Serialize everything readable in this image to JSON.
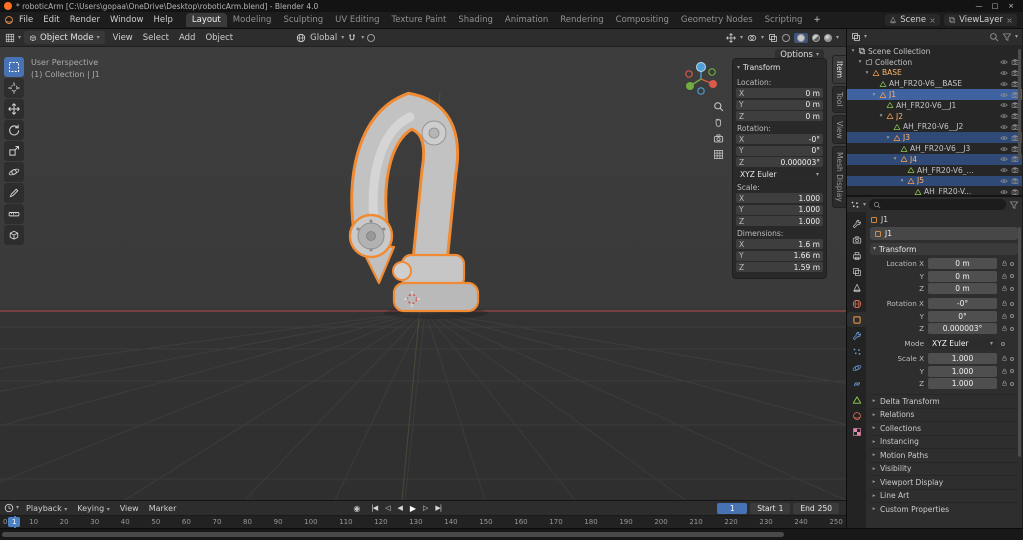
{
  "titlebar": {
    "title": "* roboticArm [C:\\Users\\gopaa\\OneDrive\\Desktop\\roboticArm.blend] - Blender 4.0",
    "controls": {
      "minimize": "—",
      "maximize": "□",
      "close": "×"
    }
  },
  "topbar": {
    "menus": [
      "File",
      "Edit",
      "Render",
      "Window",
      "Help"
    ],
    "workspaces": [
      "Layout",
      "Modeling",
      "Sculpting",
      "UV Editing",
      "Texture Paint",
      "Shading",
      "Animation",
      "Rendering",
      "Compositing",
      "Geometry Nodes",
      "Scripting"
    ],
    "active_workspace": "Layout",
    "add_workspace": "+",
    "scene": "Scene",
    "view_layer": "ViewLayer"
  },
  "viewport_header": {
    "mode": "Object Mode",
    "menus": [
      "View",
      "Select",
      "Add",
      "Object"
    ],
    "orientation": "Global",
    "options": "Options"
  },
  "toolbar": {
    "active": "select-box",
    "tools": [
      {
        "name": "select-box",
        "icon": "select"
      },
      {
        "name": "cursor",
        "icon": "cursor3d"
      },
      {
        "name": "move",
        "icon": "move"
      },
      {
        "name": "rotate",
        "icon": "rotate"
      },
      {
        "name": "scale",
        "icon": "scale"
      },
      {
        "name": "transform",
        "icon": "orbit"
      },
      {
        "name": "annotate",
        "icon": "annotate"
      },
      {
        "name": "measure",
        "icon": "measure"
      },
      {
        "name": "add-cube",
        "icon": "addcube"
      }
    ]
  },
  "viewport": {
    "overlay_line1": "User Perspective",
    "overlay_line2": "(1) Collection | J1"
  },
  "npanel": {
    "title": "Transform",
    "tabs": [
      {
        "label": "Item",
        "active": true
      },
      {
        "label": "Tool"
      },
      {
        "label": "View"
      },
      {
        "label": "Mesh Display"
      }
    ],
    "groups": [
      {
        "label": "Location:",
        "rows": [
          {
            "axis": "X",
            "value": "0 m"
          },
          {
            "axis": "Y",
            "value": "0 m"
          },
          {
            "axis": "Z",
            "value": "0 m"
          }
        ]
      },
      {
        "label": "Rotation:",
        "rows": [
          {
            "axis": "X",
            "value": "-0°"
          },
          {
            "axis": "Y",
            "value": "0°"
          },
          {
            "axis": "Z",
            "value": "0.000003°"
          }
        ],
        "dropdown": "XYZ Euler"
      },
      {
        "label": "Scale:",
        "rows": [
          {
            "axis": "X",
            "value": "1.000"
          },
          {
            "axis": "Y",
            "value": "1.000"
          },
          {
            "axis": "Z",
            "value": "1.000"
          }
        ]
      },
      {
        "label": "Dimensions:",
        "rows": [
          {
            "axis": "X",
            "value": "1.6 m"
          },
          {
            "axis": "Y",
            "value": "1.66 m"
          },
          {
            "axis": "Z",
            "value": "1.59 m"
          }
        ]
      }
    ]
  },
  "outliner": {
    "rows": [
      {
        "label": "Scene Collection",
        "icon": "scenecoll",
        "depth": 0,
        "expand": true,
        "tools": false
      },
      {
        "label": "Collection",
        "icon": "collection",
        "depth": 1,
        "expand": true
      },
      {
        "label": "BASE",
        "icon": "object",
        "depth": 2,
        "expand": true,
        "orange": true
      },
      {
        "label": "AH_FR20-V6__BASE",
        "icon": "mesh",
        "depth": 3
      },
      {
        "label": "J1",
        "icon": "object",
        "depth": 3,
        "expand": true,
        "orange": true,
        "state": "active"
      },
      {
        "label": "AH_FR20-V6__J1",
        "icon": "mesh",
        "depth": 4
      },
      {
        "label": "J2",
        "icon": "object",
        "depth": 4,
        "expand": true,
        "orange": true
      },
      {
        "label": "AH_FR20-V6__J2",
        "icon": "mesh",
        "depth": 5
      },
      {
        "label": "J3",
        "icon": "object",
        "depth": 5,
        "expand": true,
        "orange": true,
        "state": "selected"
      },
      {
        "label": "AH_FR20-V6__J3",
        "icon": "mesh",
        "depth": 6
      },
      {
        "label": "J4",
        "icon": "object",
        "depth": 6,
        "expand": true,
        "orange": true,
        "state": "selected"
      },
      {
        "label": "AH_FR20-V6_...",
        "icon": "mesh",
        "depth": 7
      },
      {
        "label": "J5",
        "icon": "object",
        "depth": 7,
        "expand": true,
        "orange": true,
        "state": "selected"
      },
      {
        "label": "AH_FR20-V...",
        "icon": "mesh",
        "depth": 8
      }
    ]
  },
  "properties": {
    "breadcrumb": "J1",
    "name": "J1",
    "tabs": [
      {
        "name": "tool",
        "icon": "wrench",
        "color": "#c0c0c0"
      },
      {
        "name": "render",
        "icon": "camera",
        "color": "#c0c0c0"
      },
      {
        "name": "output",
        "icon": "printer",
        "color": "#c0c0c0"
      },
      {
        "name": "view-layer",
        "icon": "layers",
        "color": "#c0c0c0"
      },
      {
        "name": "scene",
        "icon": "cone",
        "color": "#c0c0c0"
      },
      {
        "name": "world",
        "icon": "globe",
        "color": "#e07358"
      },
      {
        "name": "object",
        "icon": "square",
        "color": "#ffa24f",
        "active": true
      },
      {
        "name": "modifiers",
        "icon": "wrench",
        "color": "#6f9fd8"
      },
      {
        "name": "particles",
        "icon": "dots",
        "color": "#6f9fd8"
      },
      {
        "name": "physics",
        "icon": "orbit",
        "color": "#6f9fd8"
      },
      {
        "name": "constraints",
        "icon": "link",
        "color": "#6f9fd8"
      },
      {
        "name": "object-data",
        "icon": "triangle",
        "color": "#8fd14f"
      },
      {
        "name": "material",
        "icon": "sphere",
        "color": "#e07358"
      },
      {
        "name": "texture",
        "icon": "checker",
        "color": "#e38ab0"
      }
    ],
    "transform": {
      "title": "Transform",
      "rows": [
        {
          "label": "Location X",
          "value": "0 m",
          "type": "field"
        },
        {
          "label": "Y",
          "value": "0 m",
          "type": "field"
        },
        {
          "label": "Z",
          "value": "0 m",
          "type": "field"
        },
        {
          "label": "Rotation X",
          "value": "-0°",
          "type": "field",
          "gap": true
        },
        {
          "label": "Y",
          "value": "0°",
          "type": "field"
        },
        {
          "label": "Z",
          "value": "0.000003°",
          "type": "field"
        },
        {
          "label": "Mode",
          "value": "XYZ Euler",
          "type": "dropdown",
          "gap": true
        },
        {
          "label": "Scale X",
          "value": "1.000",
          "type": "field",
          "gap": true
        },
        {
          "label": "Y",
          "value": "1.000",
          "type": "field"
        },
        {
          "label": "Z",
          "value": "1.000",
          "type": "field"
        }
      ]
    },
    "sections": [
      "Delta Transform",
      "Relations",
      "Collections",
      "Instancing",
      "Motion Paths",
      "Visibility",
      "Viewport Display",
      "Line Art",
      "Custom Properties"
    ]
  },
  "timeline": {
    "menus": [
      "Playback",
      "Keying",
      "View",
      "Marker"
    ],
    "controls": [
      {
        "name": "jump-to-start",
        "glyph": "|◀"
      },
      {
        "name": "previous-keyframe",
        "glyph": "◁"
      },
      {
        "name": "play-reverse",
        "glyph": "◀"
      },
      {
        "name": "play",
        "glyph": "▶"
      },
      {
        "name": "next-keyframe",
        "glyph": "▷"
      },
      {
        "name": "jump-to-end",
        "glyph": "▶|"
      }
    ],
    "frames": [
      "0",
      "10",
      "20",
      "30",
      "40",
      "50",
      "60",
      "70",
      "80",
      "90",
      "100",
      "110",
      "120",
      "130",
      "140",
      "150",
      "160",
      "170",
      "180",
      "190",
      "200",
      "210",
      "220",
      "230",
      "240",
      "250"
    ],
    "current_frame": "1",
    "start_label": "Start",
    "start_value": "1",
    "end_label": "End",
    "end_value": "250"
  },
  "colors": {
    "selection_blue": "#4772b3",
    "object_orange": "#ffa24f",
    "mesh_green": "#8fd14f",
    "outline_orange": "#f08b33",
    "axis_red": "#b34c4c"
  }
}
